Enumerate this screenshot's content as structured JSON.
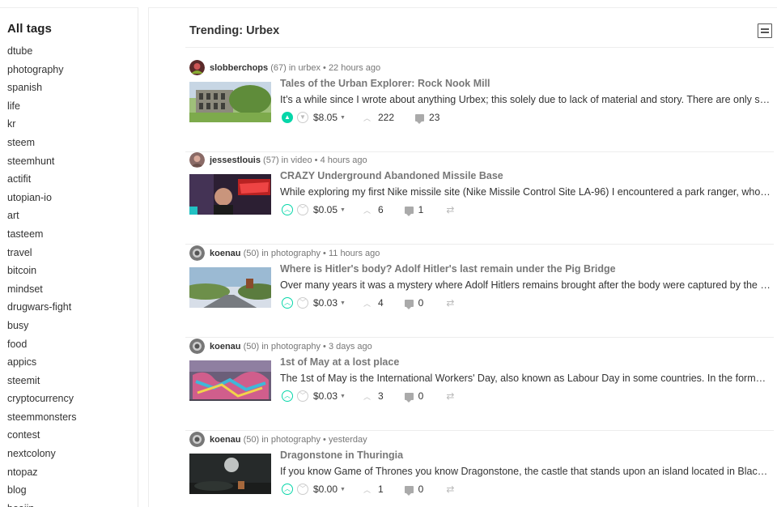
{
  "sidebar": {
    "heading": "All tags",
    "tags": [
      "dtube",
      "photography",
      "spanish",
      "life",
      "kr",
      "steem",
      "steemhunt",
      "actifit",
      "utopian-io",
      "art",
      "tasteem",
      "travel",
      "bitcoin",
      "mindset",
      "drugwars-fight",
      "busy",
      "food",
      "appics",
      "steemit",
      "cryptocurrency",
      "steemmonsters",
      "contest",
      "nextcolony",
      "ntopaz",
      "blog",
      "beejin"
    ]
  },
  "main": {
    "heading": "Trending: Urbex",
    "posts": [
      {
        "author": "slobberchops",
        "rep": "(67)",
        "in": "in",
        "category": "urbex",
        "time": "22 hours ago",
        "title": "Tales of the Urban Explorer: Rock Nook Mill",
        "summary": "It’s a while since I wrote about anything Urbex; this solely due to lack of material and story. There are only s…",
        "payout": "$8.05",
        "votes": "222",
        "replies": "23",
        "voted": true,
        "reblog": false
      },
      {
        "author": "jessestlouis",
        "rep": "(57)",
        "in": "in",
        "category": "video",
        "time": "4 hours ago",
        "title": "CRAZY Underground Abandoned Missile Base",
        "summary": "While exploring my first Nike missile site (Nike Missile Control Site LA-96) I encountered a park ranger, who…",
        "payout": "$0.05",
        "votes": "6",
        "replies": "1",
        "voted": false,
        "reblog": true
      },
      {
        "author": "koenau",
        "rep": "(50)",
        "in": "in",
        "category": "photography",
        "time": "11 hours ago",
        "title": "Where is Hitler's body? Adolf Hitler's last remain under the Pig Bridge",
        "summary": "Over many years it was a mystery where Adolf Hitlers remains brought after the body were captured by the …",
        "payout": "$0.03",
        "votes": "4",
        "replies": "0",
        "voted": false,
        "reblog": true
      },
      {
        "author": "koenau",
        "rep": "(50)",
        "in": "in",
        "category": "photography",
        "time": "3 days ago",
        "title": "1st of May at a lost place",
        "summary": "The 1st of May is the International Workers' Day, also known as Labour Day in some countries. In the forme…",
        "payout": "$0.03",
        "votes": "3",
        "replies": "0",
        "voted": false,
        "reblog": true
      },
      {
        "author": "koenau",
        "rep": "(50)",
        "in": "in",
        "category": "photography",
        "time": "yesterday",
        "title": "Dragonstone in Thuringia",
        "summary": "If you know Game of Thrones you know Dragonstone, the castle that stands upon an island located in Blac…",
        "payout": "$0.00",
        "votes": "1",
        "replies": "0",
        "voted": false,
        "reblog": true
      }
    ]
  },
  "icons": {
    "layout_toggle": "list-layout-icon",
    "upvote": "chevron-up-circle-icon",
    "downvote": "chevron-down-circle-icon",
    "votes": "chevron-up-icon",
    "replies": "comment-icon",
    "reblog": "reblog-icon"
  },
  "colors": {
    "upvote_accent": "#06d6a9"
  }
}
